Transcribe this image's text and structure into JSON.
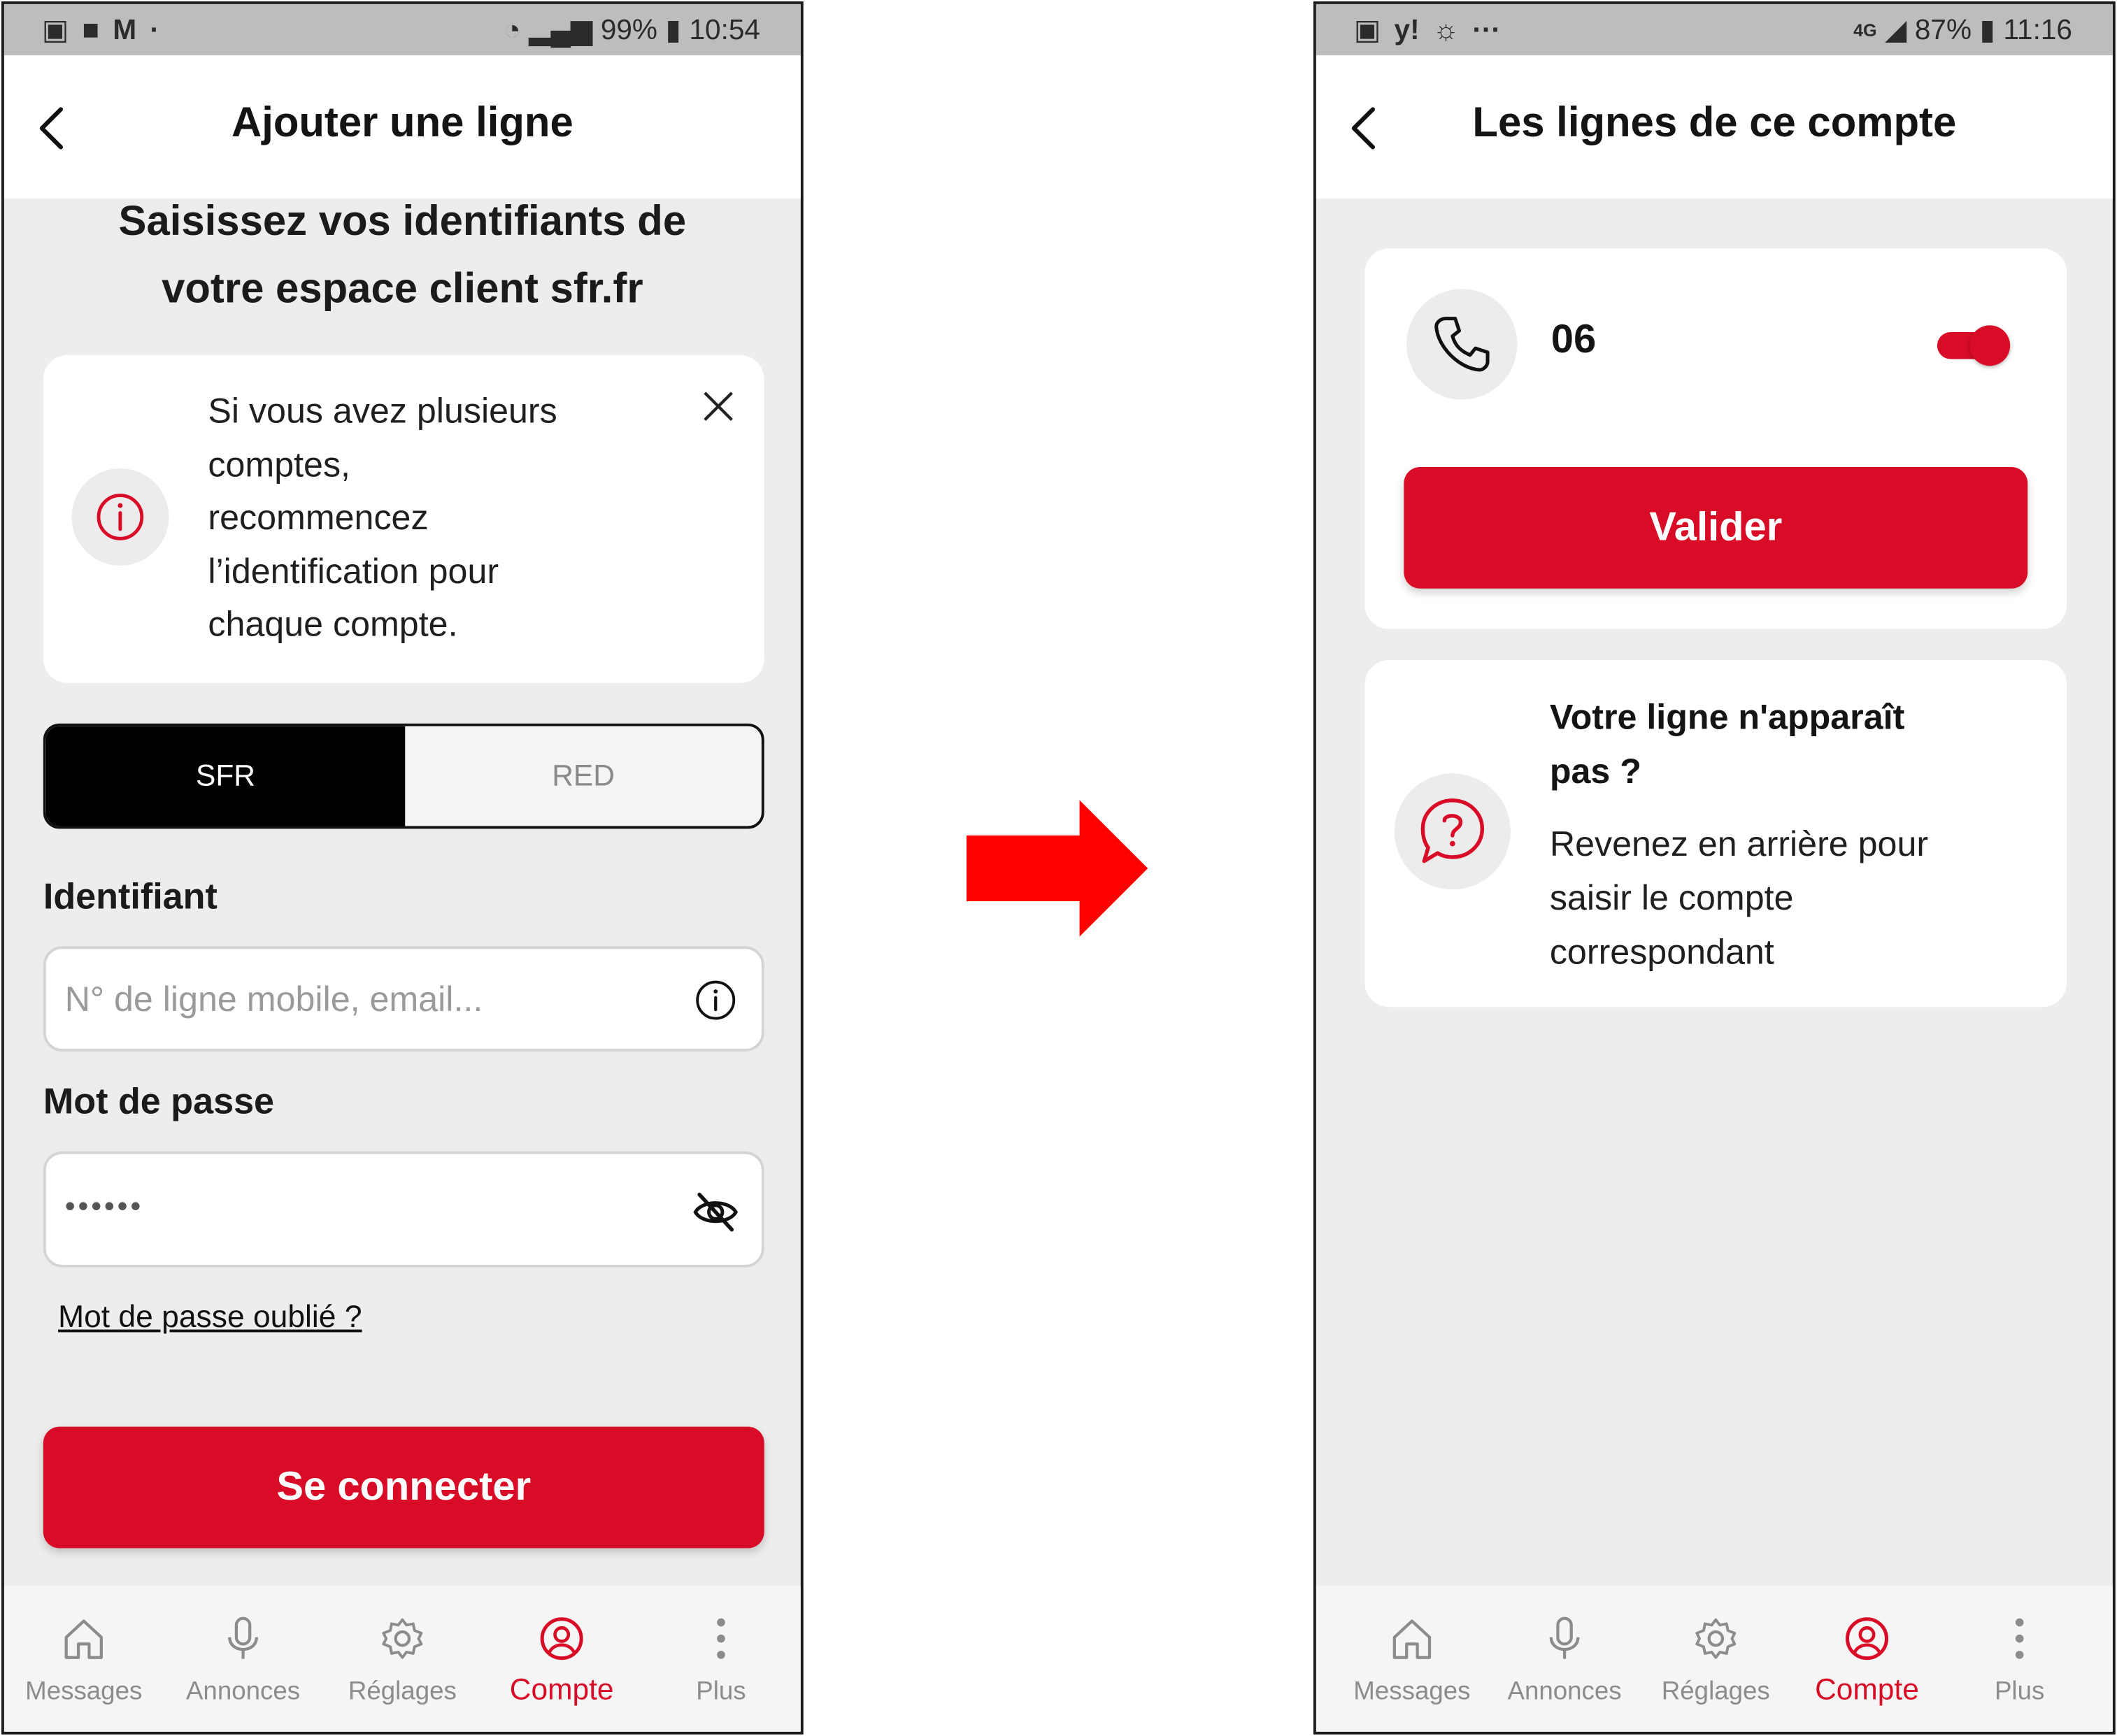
{
  "left": {
    "status": {
      "battery": "99%",
      "time": "10:54"
    },
    "header_title": "Ajouter une ligne",
    "heading": [
      "Saisissez vos identifiants de",
      "votre espace client sfr.fr"
    ],
    "info_lines": [
      "Si vous avez plusieurs",
      "comptes,",
      "recommencez",
      "l’identification pour",
      "chaque compte."
    ],
    "toggle": {
      "active": "SFR",
      "inactive": "RED"
    },
    "identifiant_label": "Identifiant",
    "identifiant_placeholder": "N° de ligne mobile, email...",
    "password_label": "Mot de passe",
    "password_value": "••••••",
    "forgot": "Mot de passe oublié ?",
    "connect": "Se connecter"
  },
  "right": {
    "status": {
      "battery": "87%",
      "time": "11:16",
      "network": "4G"
    },
    "header_title": "Les lignes de ce compte",
    "line_number": "06",
    "validate": "Valider",
    "missing_title": [
      "Votre ligne n'apparaît",
      "pas ?"
    ],
    "missing_text": [
      "Revenez en arrière pour",
      "saisir le compte",
      "correspondant"
    ]
  },
  "nav": {
    "messages": "Messages",
    "annonces": "Annonces",
    "reglages": "Réglages",
    "compte": "Compte",
    "plus": "Plus"
  },
  "colors": {
    "brand_red": "#d90c27",
    "arrow_red": "#ff0000",
    "screen_bg": "#ededed"
  },
  "icons": [
    "back-chevron-icon",
    "info-icon",
    "close-icon",
    "eye-off-icon",
    "phone-icon",
    "question-bubble-icon",
    "home-icon",
    "microphone-icon",
    "gear-icon",
    "user-circle-icon",
    "more-vertical-icon",
    "arrow-right-icon"
  ]
}
